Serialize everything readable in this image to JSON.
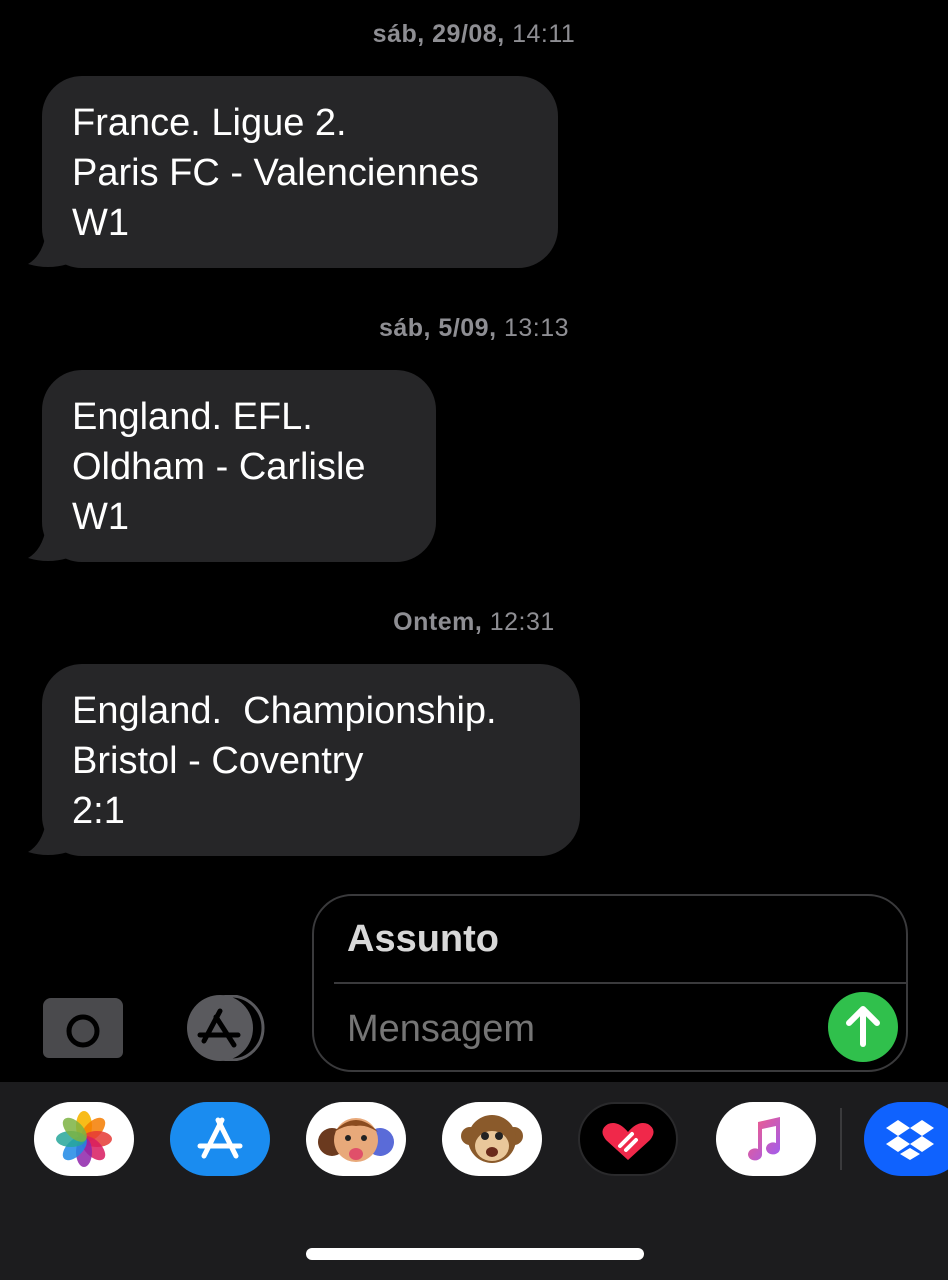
{
  "conversation": [
    {
      "timestamp_day": "sáb, 29/08,",
      "timestamp_time": "14:11",
      "lines": [
        "France. Ligue 2.",
        "Paris FC - Valenciennes",
        "W1"
      ]
    },
    {
      "timestamp_day": "sáb, 5/09,",
      "timestamp_time": "13:13",
      "lines": [
        "England. EFL.",
        "Oldham - Carlisle",
        "W1"
      ]
    },
    {
      "timestamp_day": "Ontem,",
      "timestamp_time": "12:31",
      "lines": [
        "England.  Championship.",
        "Bristol - Coventry",
        "2:1"
      ]
    }
  ],
  "composer": {
    "subject_label": "Assunto",
    "message_placeholder": "Mensagem"
  },
  "icons": {
    "camera": "camera-icon",
    "apps": "app-store-icon",
    "send": "arrow-up-icon"
  },
  "app_drawer": [
    {
      "name": "photos-app-icon"
    },
    {
      "name": "app-store-app-icon"
    },
    {
      "name": "memoji-app-icon"
    },
    {
      "name": "animoji-app-icon"
    },
    {
      "name": "digital-touch-app-icon"
    },
    {
      "name": "music-app-icon"
    },
    {
      "name": "dropbox-app-icon"
    }
  ],
  "colors": {
    "background": "#000000",
    "bubble": "#262628",
    "send": "#30c04c",
    "timestamp": "#8e8e93"
  }
}
